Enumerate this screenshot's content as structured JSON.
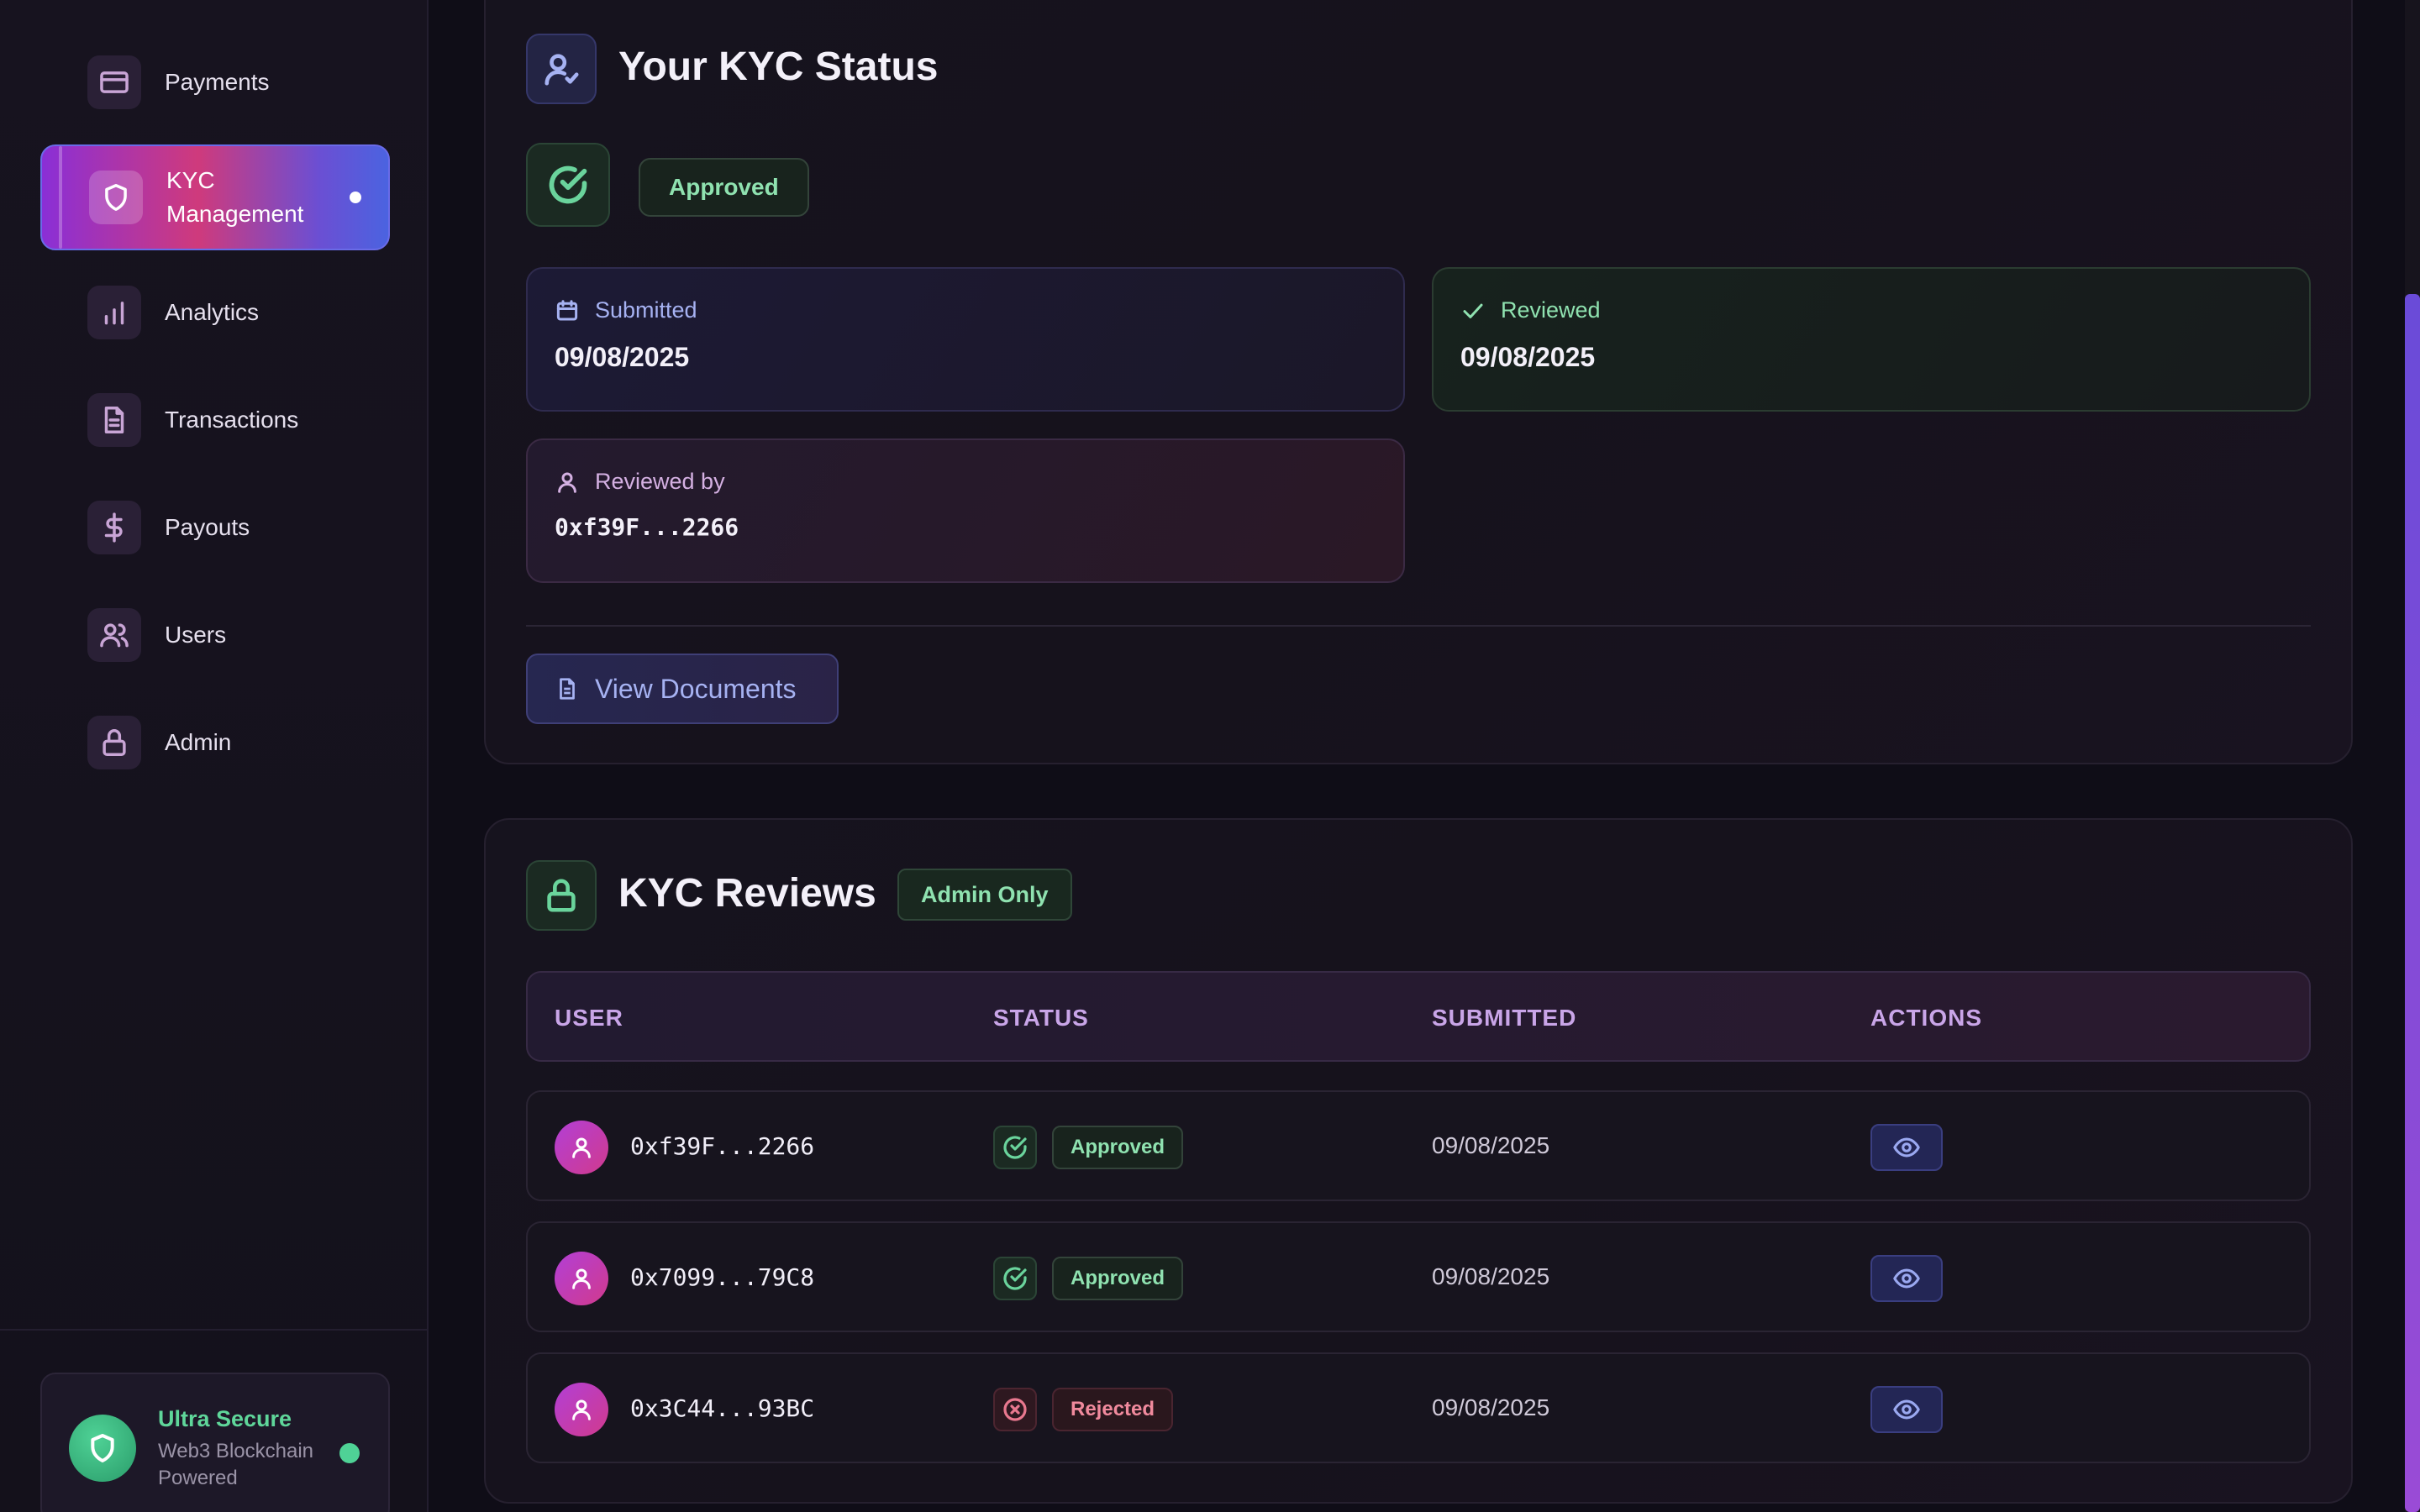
{
  "sidebar": {
    "items": [
      {
        "label": "Payments",
        "icon": "credit-card-icon"
      },
      {
        "label": "KYC\nManagement",
        "icon": "shield-icon",
        "active": true
      },
      {
        "label": "Analytics",
        "icon": "bar-chart-icon"
      },
      {
        "label": "Transactions",
        "icon": "document-icon"
      },
      {
        "label": "Payouts",
        "icon": "dollar-icon"
      },
      {
        "label": "Users",
        "icon": "users-icon"
      },
      {
        "label": "Admin",
        "icon": "lock-icon"
      }
    ],
    "security": {
      "title": "Ultra Secure",
      "subtitle": "Web3 Blockchain Powered",
      "icon": "shield-icon",
      "status_color": "#4fd296"
    }
  },
  "kyc_status": {
    "title": "Your KYC Status",
    "status": "Approved",
    "submitted_label": "Submitted",
    "submitted_date": "09/08/2025",
    "reviewed_label": "Reviewed",
    "reviewed_date": "09/08/2025",
    "reviewer_label": "Reviewed by",
    "reviewer": "0xf39F...2266",
    "view_documents": "View Documents"
  },
  "kyc_reviews": {
    "title": "KYC Reviews",
    "badge": "Admin Only",
    "columns": [
      "USER",
      "STATUS",
      "SUBMITTED",
      "ACTIONS"
    ],
    "rows": [
      {
        "user": "0xf39F...2266",
        "status": "Approved",
        "submitted": "09/08/2025"
      },
      {
        "user": "0x7099...79C8",
        "status": "Approved",
        "submitted": "09/08/2025"
      },
      {
        "user": "0x3C44...93BC",
        "status": "Rejected",
        "submitted": "09/08/2025"
      }
    ]
  },
  "colors": {
    "accent_gradient_start": "#8a2fd6",
    "accent_gradient_mid": "#cf3a7c",
    "accent_gradient_end": "#4b63e0",
    "approved": "#8fe2b0",
    "rejected": "#f08a9d",
    "background": "#0f0d17"
  }
}
